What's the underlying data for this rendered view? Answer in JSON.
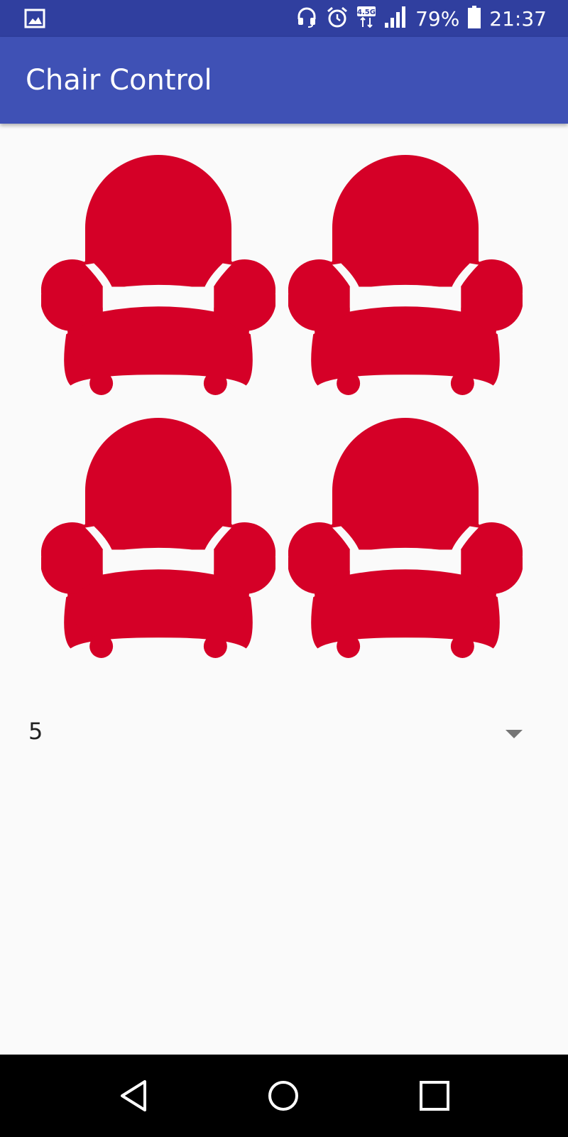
{
  "status_bar": {
    "battery_percent": "79%",
    "time": "21:37",
    "network_type": "4.5G",
    "icons": [
      "image-icon",
      "headset-icon",
      "alarm-icon",
      "network-icon",
      "signal-icon",
      "battery-icon"
    ]
  },
  "app_bar": {
    "title": "Chair Control"
  },
  "chairs": {
    "count": 4,
    "icon": "armchair-icon",
    "color": "#d50027"
  },
  "spinner": {
    "selected_value": "5",
    "icon": "dropdown-arrow-icon"
  },
  "nav_bar": {
    "icons": [
      "back-icon",
      "home-icon",
      "recents-icon"
    ]
  },
  "colors": {
    "status_bar": "#303f9f",
    "app_bar": "#3f51b5",
    "background": "#fafafa",
    "chair": "#d50027"
  }
}
